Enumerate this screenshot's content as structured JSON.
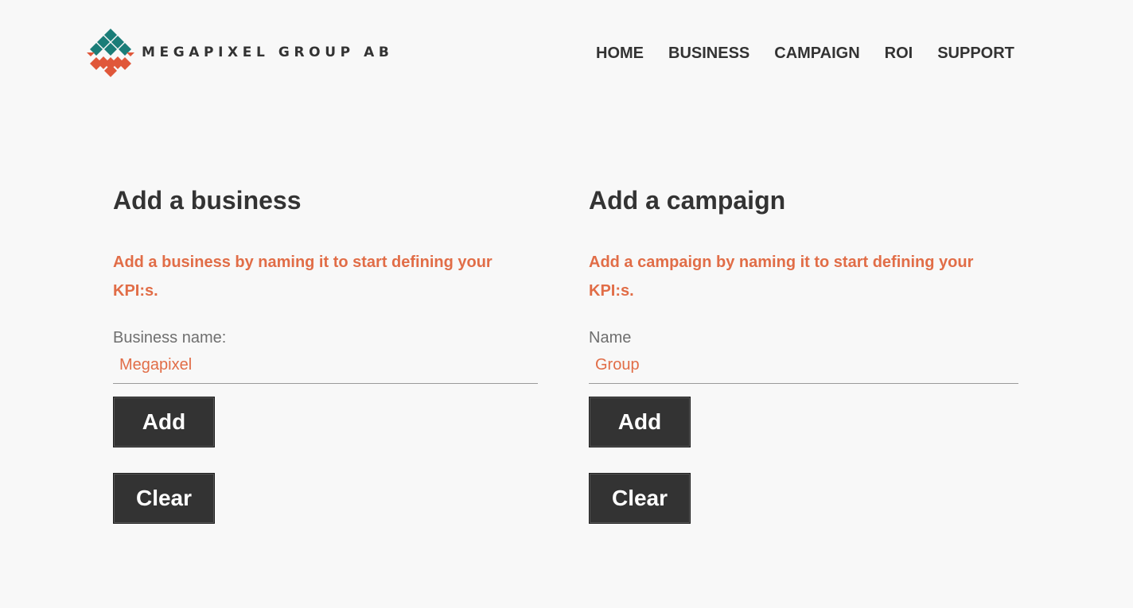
{
  "brand": {
    "name": "MEGAPIXEL GROUP AB",
    "logo_icon": "diamond-tiles-logo",
    "colors": {
      "teal": "#1a7d78",
      "orange": "#e0573a",
      "accent_text": "#e16d47",
      "button": "#333333"
    }
  },
  "nav": {
    "items": [
      {
        "label": "HOME"
      },
      {
        "label": "BUSINESS"
      },
      {
        "label": "CAMPAIGN"
      },
      {
        "label": "ROI"
      },
      {
        "label": "SUPPORT"
      }
    ]
  },
  "business": {
    "title": "Add a business",
    "intro_line1": "Add a business by naming it to start defining your",
    "intro_line2": "KPI:s.",
    "label": "Business name:",
    "value": "Megapixel",
    "add_label": "Add",
    "clear_label": "Clear"
  },
  "campaign": {
    "title": "Add a campaign",
    "intro_line1": "Add a campaign by naming it to start defining your",
    "intro_line2": "KPI:s.",
    "label": "Name",
    "value": "Group",
    "add_label": "Add",
    "clear_label": "Clear"
  }
}
